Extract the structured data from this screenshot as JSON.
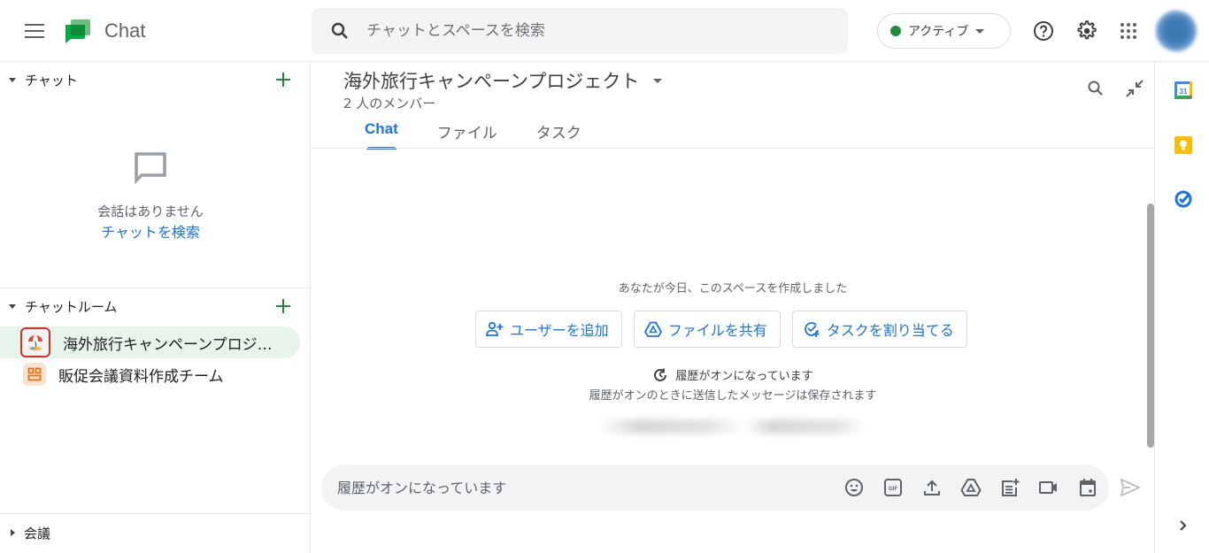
{
  "header": {
    "app_name": "Chat",
    "search_placeholder": "チャットとスペースを検索",
    "status_label": "アクティブ",
    "status_color": "#1e8e3e",
    "icons": [
      "menu-icon",
      "chat-logo",
      "search-icon",
      "help-icon",
      "settings-icon",
      "apps-grid-icon",
      "account-avatar"
    ]
  },
  "sidebar": {
    "chat_section": {
      "title": "チャット",
      "empty_message": "会話はありません",
      "search_link": "チャットを検索"
    },
    "rooms_section": {
      "title": "チャットルーム",
      "rooms": [
        {
          "name": "海外旅行キャンペーンプロジェクト",
          "icon": "beach-umbrella-icon",
          "active": true
        },
        {
          "name": "販促会議資料作成チーム",
          "icon": "team-icon",
          "active": false
        }
      ]
    },
    "meetings_section": {
      "title": "会議"
    }
  },
  "space": {
    "title": "海外旅行キャンペーンプロジェクト",
    "members": "2 人のメンバー",
    "tabs": [
      {
        "label": "Chat",
        "active": true
      },
      {
        "label": "ファイル",
        "active": false
      },
      {
        "label": "タスク",
        "active": false
      }
    ],
    "created_message": "あなたが今日、このスペースを作成しました",
    "actions": [
      {
        "label": "ユーザーを追加",
        "icon": "add-person-icon"
      },
      {
        "label": "ファイルを共有",
        "icon": "drive-icon"
      },
      {
        "label": "タスクを割り当てる",
        "icon": "add-task-icon"
      }
    ],
    "history_on": "履歴がオンになっています",
    "history_sub": "履歴がオンのときに送信したメッセージは保存されます",
    "composer_placeholder": "履歴がオンになっています",
    "composer_icons": [
      "emoji-icon",
      "gif-icon",
      "upload-icon",
      "drive-icon",
      "create-doc-icon",
      "video-meeting-icon",
      "calendar-event-icon"
    ]
  },
  "rightbar": {
    "apps": [
      "calendar-icon",
      "keep-icon",
      "tasks-icon"
    ],
    "calendar_day": "31"
  },
  "colors": {
    "accent": "#1a73e8",
    "active_room_bg": "#e6f4ea",
    "add_green": "#1e8e3e"
  }
}
